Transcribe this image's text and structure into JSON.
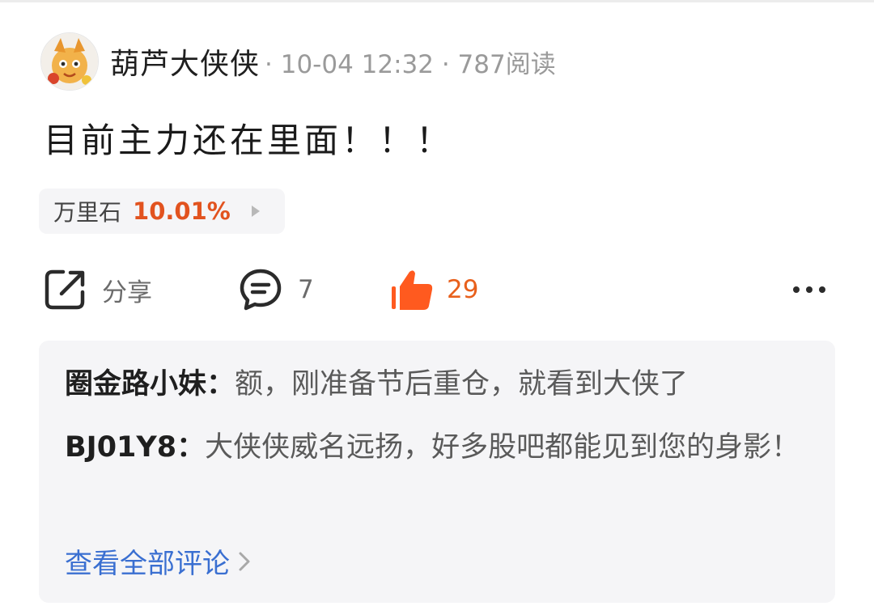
{
  "post": {
    "author": "葫芦大侠侠",
    "meta": "· 10-04 12:32 · 787阅读",
    "text": "目前主力还在里面！！！",
    "avatar_icon": "fox-mascot-avatar"
  },
  "stock_tag": {
    "name": "万里石",
    "change": "10.01%",
    "change_color": "#e2531f"
  },
  "actions": {
    "share_label": "分享",
    "comment_count": "7",
    "like_count": "29",
    "like_color": "#ff5a1f",
    "more_icon": "more-dots-icon"
  },
  "comments": [
    {
      "author": "圈金路小妹：",
      "text": "额，刚准备节后重仓，就看到大侠了"
    },
    {
      "author": "BJ01Y8：",
      "text": "大侠侠威名远扬，好多股吧都能见到您的身影！"
    }
  ],
  "view_all_label": "查看全部评论"
}
